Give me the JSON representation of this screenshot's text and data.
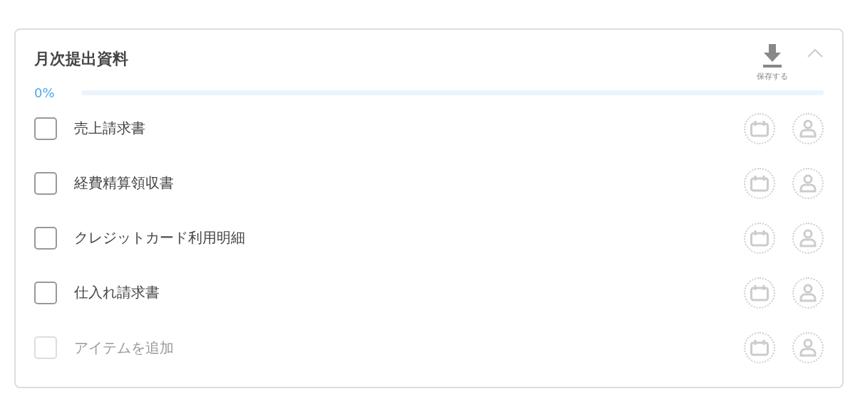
{
  "card": {
    "title": "月次提出資料",
    "expanded": true,
    "save_label": "保存する",
    "progress": {
      "reading": "0%",
      "level": 0
    },
    "items": [
      {
        "kind": "task",
        "label": "売上請求書",
        "checked": false
      },
      {
        "kind": "task",
        "label": "経費精算領収書",
        "checked": false
      },
      {
        "kind": "task",
        "label": "クレジットカード利用明細",
        "checked": false
      },
      {
        "kind": "task",
        "label": "仕入れ請求書",
        "checked": false
      },
      {
        "kind": "new",
        "placeholder": "アイテムを追加",
        "checked": false
      }
    ]
  }
}
